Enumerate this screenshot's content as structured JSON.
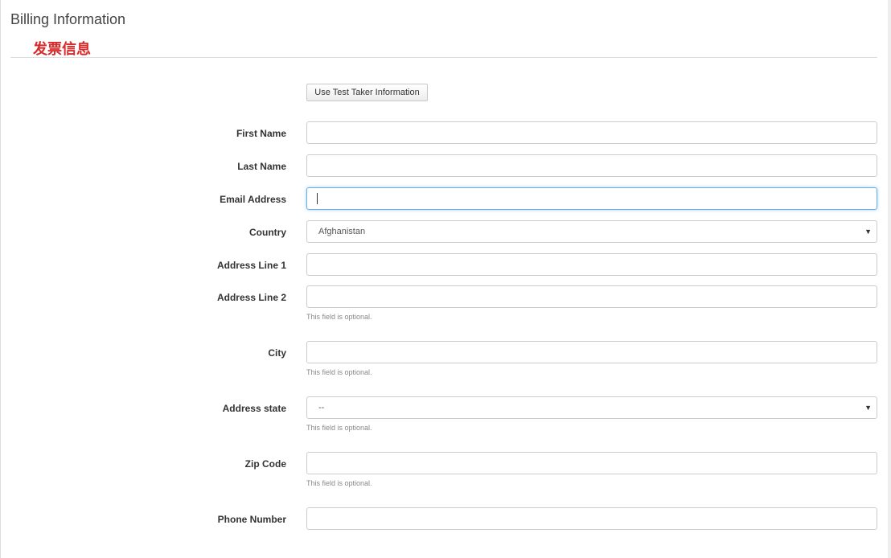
{
  "header": {
    "title": "Billing Information",
    "subtitle": "发票信息"
  },
  "actions": {
    "use_test_taker_label": "Use Test Taker Information"
  },
  "form": {
    "first_name": {
      "label": "First Name",
      "value": ""
    },
    "last_name": {
      "label": "Last Name",
      "value": ""
    },
    "email": {
      "label": "Email Address",
      "value": ""
    },
    "country": {
      "label": "Country",
      "selected": "Afghanistan"
    },
    "address1": {
      "label": "Address Line 1",
      "value": ""
    },
    "address2": {
      "label": "Address Line 2",
      "value": "",
      "help": "This field is optional."
    },
    "city": {
      "label": "City",
      "value": "",
      "help": "This field is optional."
    },
    "state": {
      "label": "Address state",
      "selected": "--",
      "help": "This field is optional."
    },
    "zip": {
      "label": "Zip Code",
      "value": "",
      "help": "This field is optional."
    },
    "phone": {
      "label": "Phone Number",
      "value": ""
    }
  },
  "icons": {
    "dropdown": "chevron-down-icon"
  },
  "colors": {
    "accent_red": "#d82a2a",
    "focus_blue": "#66afe9"
  }
}
